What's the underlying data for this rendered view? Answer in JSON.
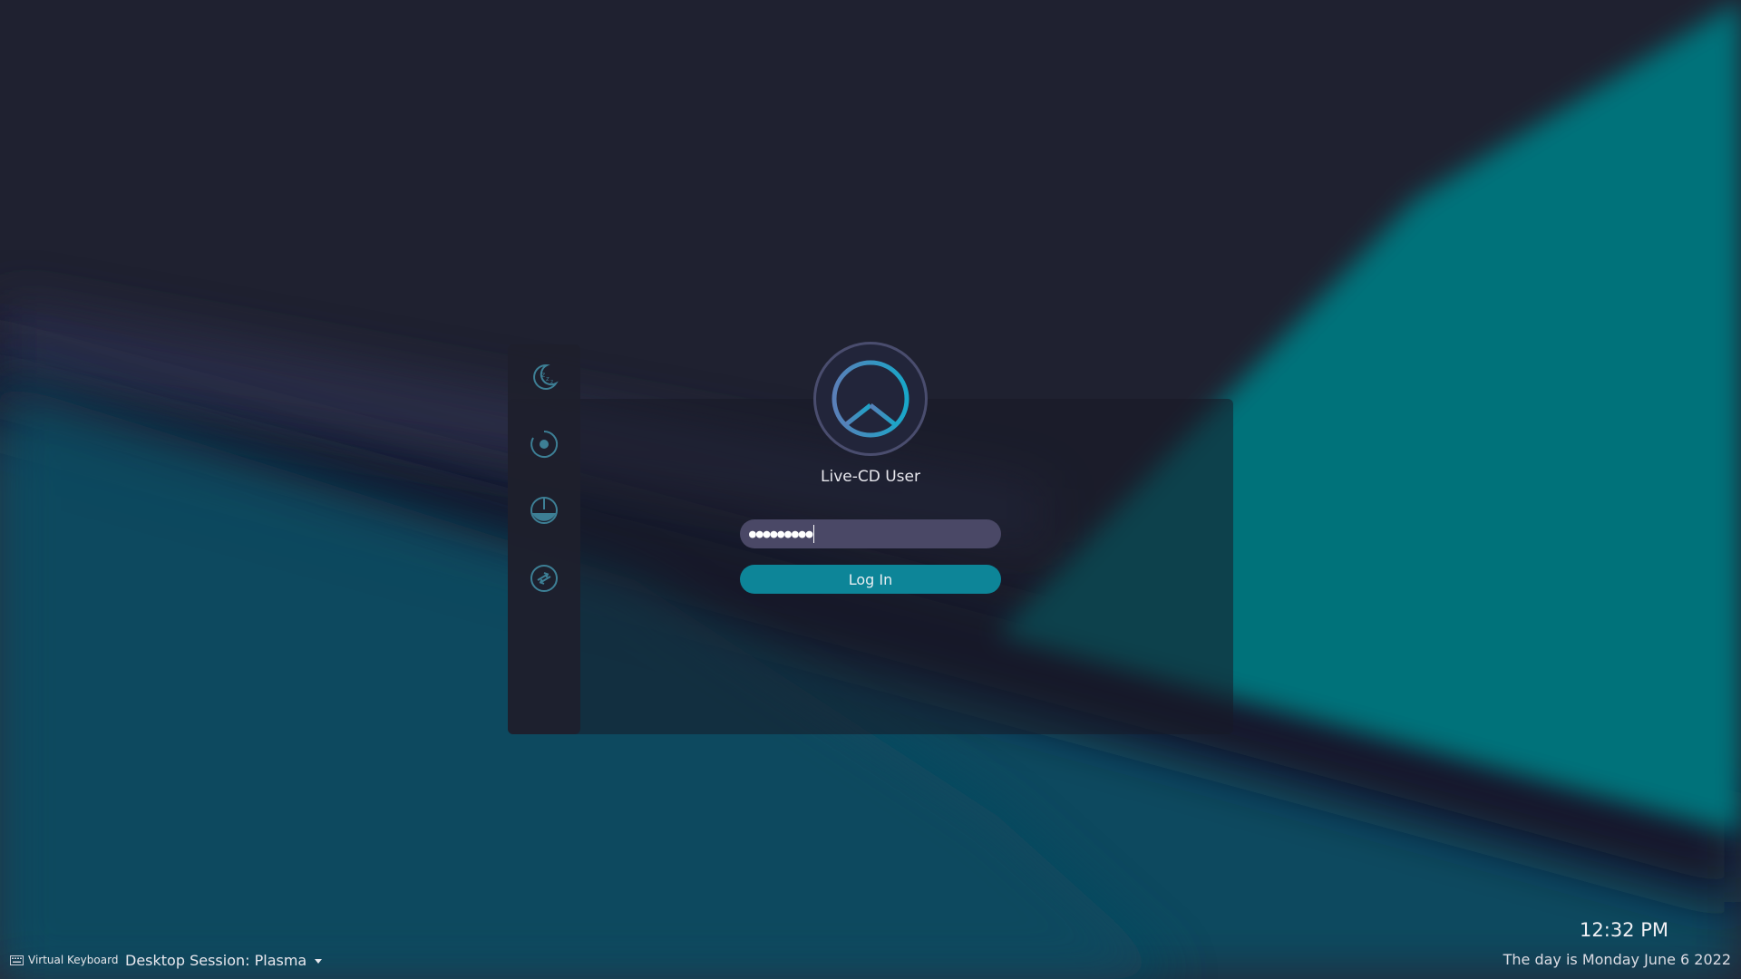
{
  "colors": {
    "background_dark": "#1f2130",
    "teal": "#04727a",
    "deep_teal": "#094a5e",
    "accent_button": "#0d8598",
    "password_field": "#4a4866"
  },
  "side_actions": [
    {
      "name": "suspend",
      "icon": "sleep-icon"
    },
    {
      "name": "restart",
      "icon": "restart-icon"
    },
    {
      "name": "shutdown",
      "icon": "power-icon"
    },
    {
      "name": "switch-user",
      "icon": "switch-user-icon"
    }
  ],
  "user": {
    "avatar_icon": "peace-symbol-icon",
    "name": "Live-CD User"
  },
  "login": {
    "password_masked": "●●●●●●●●●",
    "button_label": "Log In"
  },
  "footer": {
    "virtual_keyboard_label": "Virtual Keyboard",
    "session_label": "Desktop Session: Plasma",
    "time": "12:32 PM",
    "date": "The day is Monday June 6 2022"
  }
}
